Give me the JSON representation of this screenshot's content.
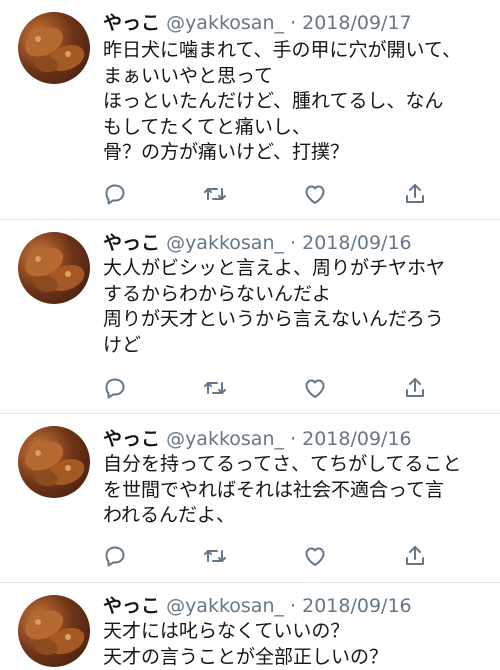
{
  "colors": {
    "icon_gray": "#657786",
    "text": "#14171a",
    "divider": "#e1e8ed"
  },
  "icons": [
    "reply-icon",
    "retweet-icon",
    "like-icon",
    "share-icon"
  ],
  "tweets": [
    {
      "name": "やっこ",
      "meta": "@yakkosan_ · 2018/09/17",
      "lines": [
        "昨日犬に噛まれて、手の甲に穴が開いて、",
        "まぁいいやと思って",
        "ほっといたんだけど、腫れてるし、なん",
        "もしてたくてと痛いし、",
        "骨？の方が痛いけど、打撲？"
      ]
    },
    {
      "name": "やっこ",
      "meta": "@yakkosan_ · 2018/09/16",
      "lines": [
        "大人がビシッと言えよ、周りがチヤホヤ",
        "するからわからないんだよ",
        "周りが天才というから言えないんだろう",
        "けど"
      ]
    },
    {
      "name": "やっこ",
      "meta": "@yakkosan_ · 2018/09/16",
      "lines": [
        "自分を持ってるってさ、てちがしてること",
        "を世間でやればそれは社会不適合って言",
        "われるんだよ、"
      ]
    },
    {
      "name": "やっこ",
      "meta": "@yakkosan_ · 2018/09/16",
      "lines": [
        "天才には叱らなくていいの？",
        "天才の言うことが全部正しいの？"
      ]
    }
  ]
}
